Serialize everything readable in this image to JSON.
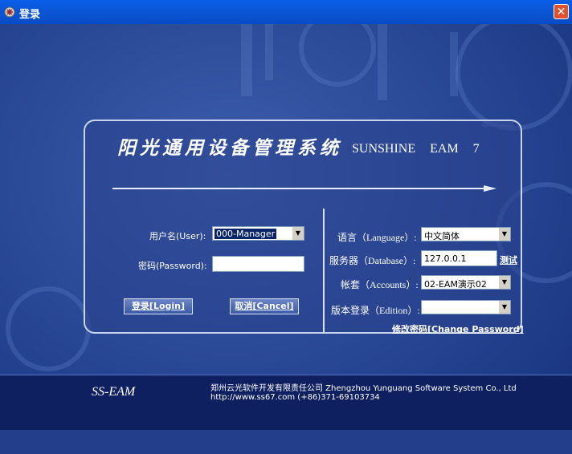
{
  "window": {
    "title": "登录",
    "close_glyph": "✕"
  },
  "header": {
    "system_name": "阳光通用设备管理系统",
    "system_sub": "SUNSHINE EAM 7"
  },
  "left": {
    "user_label": "用户名(User):",
    "user_value": "000-Manager",
    "password_label": "密码(Password):",
    "password_value": "",
    "login_button": "登录[Login]",
    "cancel_button": "取消[Cancel]"
  },
  "right": {
    "language_label": "语言（Language）:",
    "language_value": "中文简体",
    "database_label": "服务器（Database）:",
    "database_value": "127.0.0.1",
    "test_link": "测试",
    "accounts_label": "帐套（Accounts）:",
    "accounts_value": "02-EAM演示02",
    "edition_label": "版本登录（Edition）:",
    "edition_value": "",
    "change_password_link": "修改密码[Change Password]"
  },
  "footer": {
    "brand": "SS-EAM",
    "company": "郑州云光软件开发有限责任公司 Zhengzhou Yunguang Software System Co., Ltd",
    "contact": "http://www.ss67.com      (+86)371-69103734"
  },
  "colors": {
    "titlebar": "#0a57d8",
    "background": "#1c3b87",
    "footer": "#0f2060",
    "close": "#e0512f"
  }
}
